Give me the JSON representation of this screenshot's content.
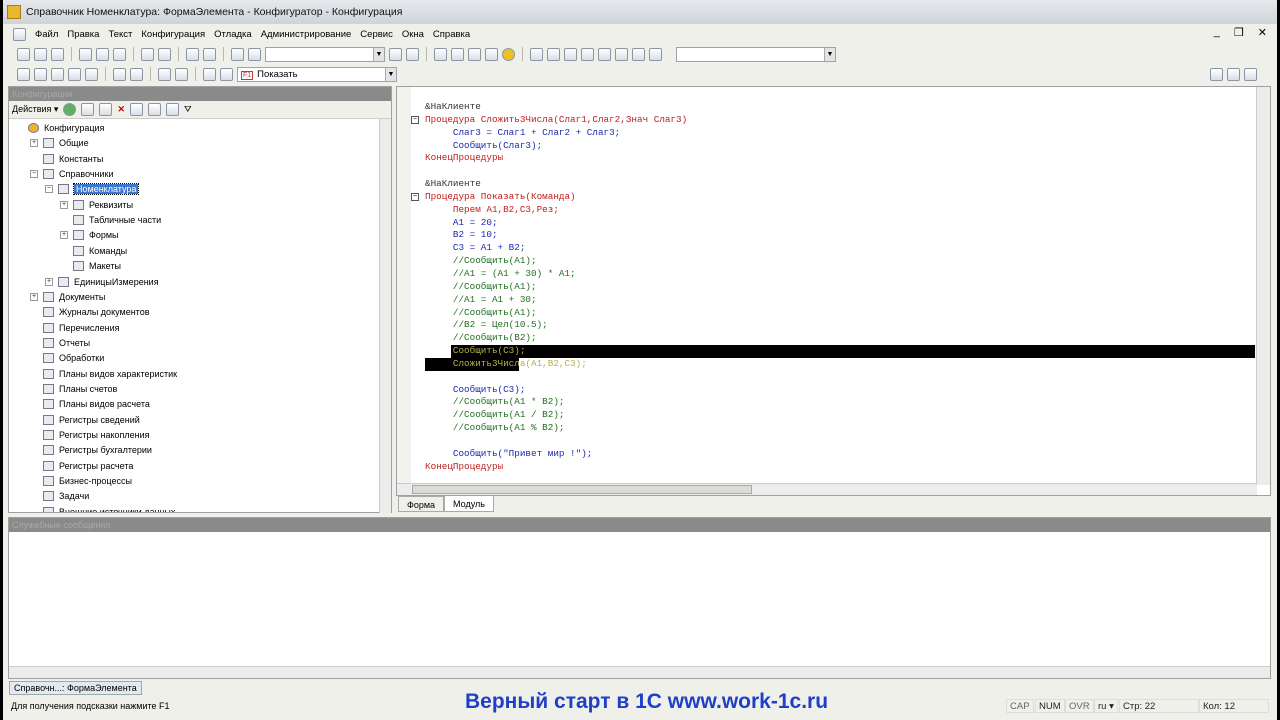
{
  "window": {
    "title": "Справочник Номенклатура: ФормаЭлемента - Конфигуратор - Конфигурация"
  },
  "menu": [
    "Файл",
    "Правка",
    "Текст",
    "Конфигурация",
    "Отладка",
    "Администрирование",
    "Сервис",
    "Окна",
    "Справка"
  ],
  "toolbar2": {
    "procedure_combo": "Показать",
    "procedure_badge": "F1"
  },
  "left_panel": {
    "title": "Конфигурация",
    "actions_label": "Действия ▾",
    "tree": [
      {
        "label": "Конфигурация",
        "level": 0,
        "exp": ""
      },
      {
        "label": "Общие",
        "level": 1,
        "exp": "+"
      },
      {
        "label": "Константы",
        "level": 1,
        "exp": ""
      },
      {
        "label": "Справочники",
        "level": 1,
        "exp": "−"
      },
      {
        "label": "Номенклатура",
        "level": 2,
        "exp": "−",
        "selected": true
      },
      {
        "label": "Реквизиты",
        "level": 3,
        "exp": "+"
      },
      {
        "label": "Табличные части",
        "level": 3,
        "exp": ""
      },
      {
        "label": "Формы",
        "level": 3,
        "exp": "+"
      },
      {
        "label": "Команды",
        "level": 3,
        "exp": ""
      },
      {
        "label": "Макеты",
        "level": 3,
        "exp": ""
      },
      {
        "label": "ЕдиницыИзмерения",
        "level": 2,
        "exp": "+"
      },
      {
        "label": "Документы",
        "level": 1,
        "exp": "+"
      },
      {
        "label": "Журналы документов",
        "level": 1,
        "exp": ""
      },
      {
        "label": "Перечисления",
        "level": 1,
        "exp": ""
      },
      {
        "label": "Отчеты",
        "level": 1,
        "exp": ""
      },
      {
        "label": "Обработки",
        "level": 1,
        "exp": ""
      },
      {
        "label": "Планы видов характеристик",
        "level": 1,
        "exp": ""
      },
      {
        "label": "Планы счетов",
        "level": 1,
        "exp": ""
      },
      {
        "label": "Планы видов расчета",
        "level": 1,
        "exp": ""
      },
      {
        "label": "Регистры сведений",
        "level": 1,
        "exp": ""
      },
      {
        "label": "Регистры накопления",
        "level": 1,
        "exp": ""
      },
      {
        "label": "Регистры бухгалтерии",
        "level": 1,
        "exp": ""
      },
      {
        "label": "Регистры расчета",
        "level": 1,
        "exp": ""
      },
      {
        "label": "Бизнес-процессы",
        "level": 1,
        "exp": ""
      },
      {
        "label": "Задачи",
        "level": 1,
        "exp": ""
      },
      {
        "label": "Внешние источники данных",
        "level": 1,
        "exp": ""
      }
    ]
  },
  "code": [
    "&НаКлиенте",
    "Процедура Сложить3Числа(Слаг1,Слаг2,Знач Слаг3)",
    "     Слаг3 = Слаг1 + Слаг2 + Слаг3;",
    "     Сообщить(Слаг3);",
    "КонецПроцедуры",
    "",
    "&НаКлиенте",
    "Процедура Показать(Команда)",
    "     Перем А1,В2,С3,Рез;",
    "     А1 = 20;",
    "     В2 = 10;",
    "     С3 = А1 + В2;",
    "     //Сообщить(А1);",
    "     //А1 = (А1 + 30) * А1;",
    "     //Сообщить(А1);",
    "     //А1 = А1 + 30;",
    "     //Сообщить(А1);",
    "     //В2 = Цел(10.5);",
    "     //Сообщить(В2);",
    "     Сообщить(С3);",
    "     Сложить3Числа(А1,В2,С3);",
    "",
    "     Сообщить(С3);",
    "     //Сообщить(А1 * В2);",
    "     //Сообщить(А1 / В2);",
    "     //Сообщить(А1 % В2);",
    "",
    "     Сообщить(\"Привет мир !\");",
    "КонецПроцедуры"
  ],
  "editor_tabs": [
    "Форма",
    "Модуль"
  ],
  "messages_panel": {
    "title": "Служебные сообщения"
  },
  "taskbar": {
    "item": "Справочн...: ФормаЭлемента"
  },
  "status": {
    "hint": "Для получения подсказки нажмите F1",
    "cap": "CAP",
    "num": "NUM",
    "ovr": "OVR",
    "lang": "ru ▾",
    "line": "Стр: 22",
    "col": "Кол: 12"
  },
  "watermark": "Верный старт в 1С www.work-1c.ru"
}
